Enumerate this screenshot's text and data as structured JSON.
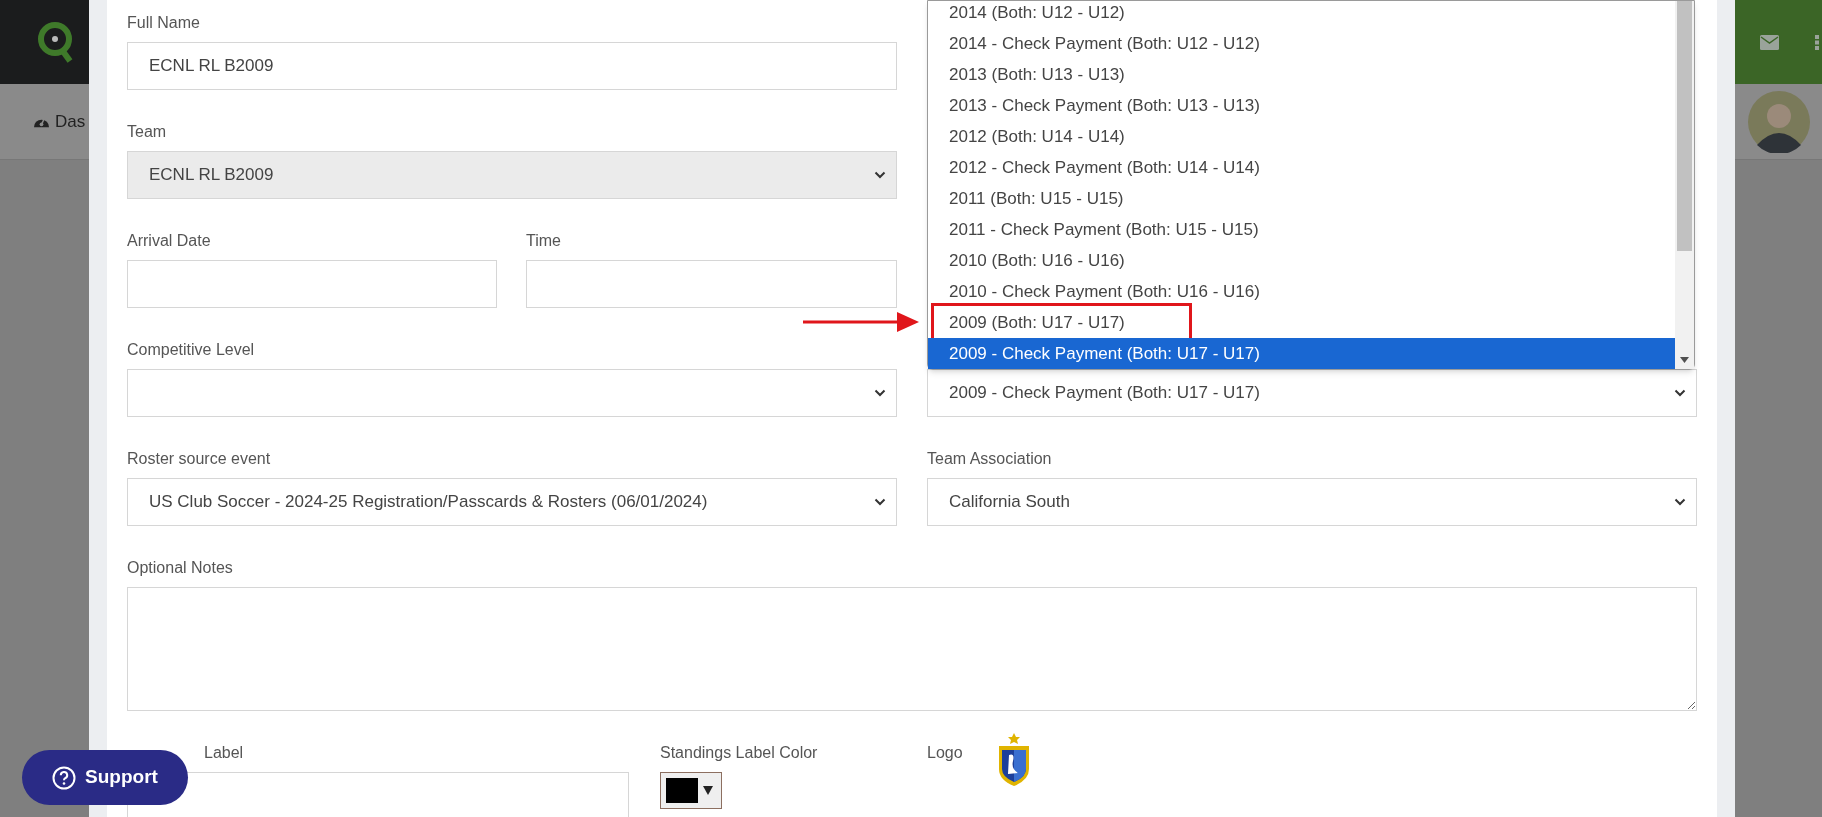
{
  "header": {
    "nav_item": "Das"
  },
  "form": {
    "rows": [
      {
        "fields": [
          {
            "kind": "text",
            "label": "Full Name",
            "value": "ECNL RL B2009",
            "disabled": false
          }
        ]
      },
      {
        "fields": [
          {
            "kind": "select",
            "label": "Team",
            "value": "ECNL RL B2009",
            "disabled": true
          }
        ]
      },
      {
        "fields": [
          {
            "kind": "text",
            "label": "Arrival Date",
            "disabled": false
          },
          {
            "kind": "text",
            "label": "Time",
            "disabled": false
          }
        ]
      },
      {
        "fields": [
          {
            "kind": "select",
            "label": "Competitive Level",
            "disabled": false
          },
          {
            "kind": "select",
            "value": "2009 - Check Payment (Both: U17 - U17)",
            "disabled": false
          }
        ]
      },
      {
        "fields": [
          {
            "kind": "select",
            "label": "Roster source event",
            "value": "US Club Soccer - 2024-25 Registration/Passcards & Rosters (06/01/2024)",
            "disabled": false
          },
          {
            "kind": "select",
            "label": "Team Association",
            "value": "California South",
            "disabled": false
          }
        ]
      },
      {
        "fields": [
          {
            "kind": "textarea",
            "label": "Optional Notes",
            "disabled": false
          }
        ]
      },
      {
        "fields": [
          {
            "kind": "text",
            "label": "Label",
            "disabled": false
          },
          {
            "kind": "color",
            "label": "Standings Label Color",
            "color": "#000000"
          },
          {
            "kind": "logo",
            "label": "Logo"
          }
        ]
      }
    ]
  },
  "dropdown": {
    "options": [
      {
        "label": "2014 (Both: U12 - U12)",
        "selected": false,
        "marked": false
      },
      {
        "label": "2014 - Check Payment (Both: U12 - U12)",
        "selected": false,
        "marked": false
      },
      {
        "label": "2013 (Both: U13 - U13)",
        "selected": false,
        "marked": false
      },
      {
        "label": "2013 - Check Payment (Both: U13 - U13)",
        "selected": false,
        "marked": false
      },
      {
        "label": "2012 (Both: U14 - U14)",
        "selected": false,
        "marked": false
      },
      {
        "label": "2012 - Check Payment (Both: U14 - U14)",
        "selected": false,
        "marked": false
      },
      {
        "label": "2011 (Both: U15 - U15)",
        "selected": false,
        "marked": false
      },
      {
        "label": "2011 - Check Payment (Both: U15 - U15)",
        "selected": false,
        "marked": false
      },
      {
        "label": "2010 (Both: U16 - U16)",
        "selected": false,
        "marked": false
      },
      {
        "label": "2010 - Check Payment (Both: U16 - U16)",
        "selected": false,
        "marked": false
      },
      {
        "label": "2009 (Both: U17 - U17)",
        "selected": false,
        "marked": true
      },
      {
        "label": "2009 - Check Payment (Both: U17 - U17)",
        "selected": true,
        "marked": false
      }
    ]
  },
  "support_button": {
    "label": "Support"
  }
}
